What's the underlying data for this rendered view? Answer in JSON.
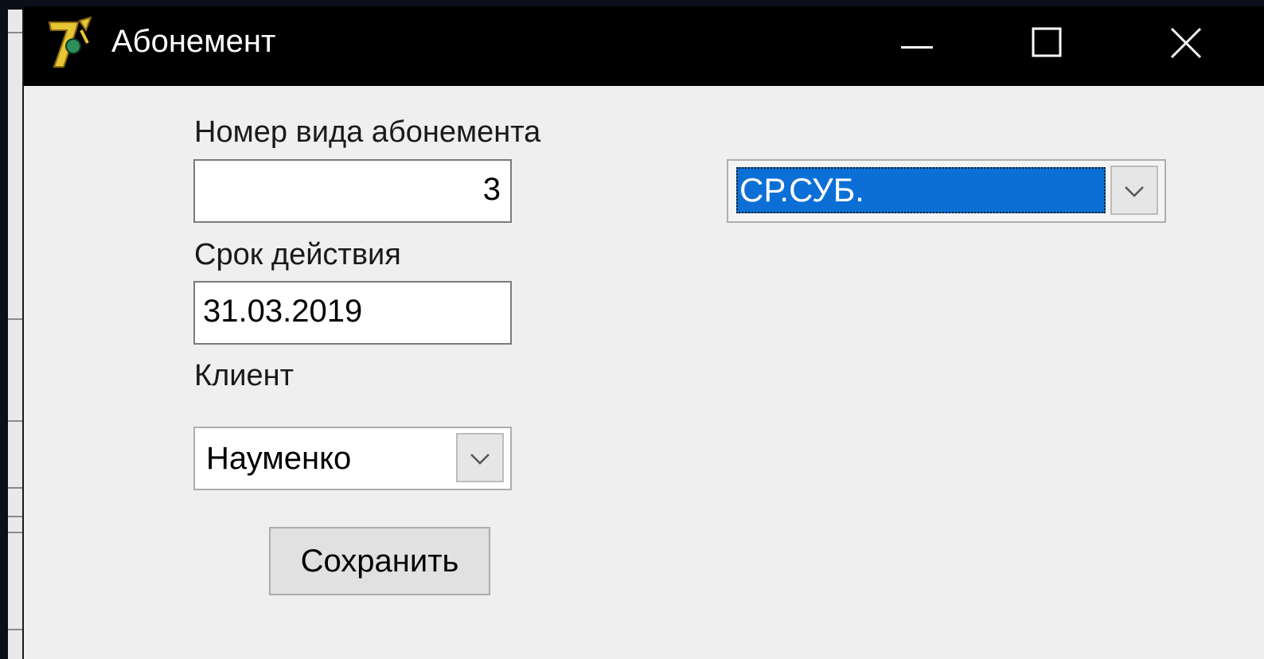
{
  "window": {
    "title": "Абонемент"
  },
  "form": {
    "subscription_type_label": "Номер вида абонемента",
    "subscription_type_value": "3",
    "validity_label": "Срок действия",
    "validity_value": "31.03.2019",
    "client_label": "Клиент",
    "client_value": "Науменко",
    "type_combo_value": "СР.СУБ.",
    "save_label": "Сохранить"
  },
  "colors": {
    "titlebar": "#000000",
    "window_bg": "#efefef",
    "selection": "#0b6fd6"
  },
  "icons": {
    "app": "delphi-7-app-icon",
    "minimize": "minimize-icon",
    "maximize": "maximize-icon",
    "close": "close-icon",
    "dropdown": "chevron-down-icon"
  }
}
